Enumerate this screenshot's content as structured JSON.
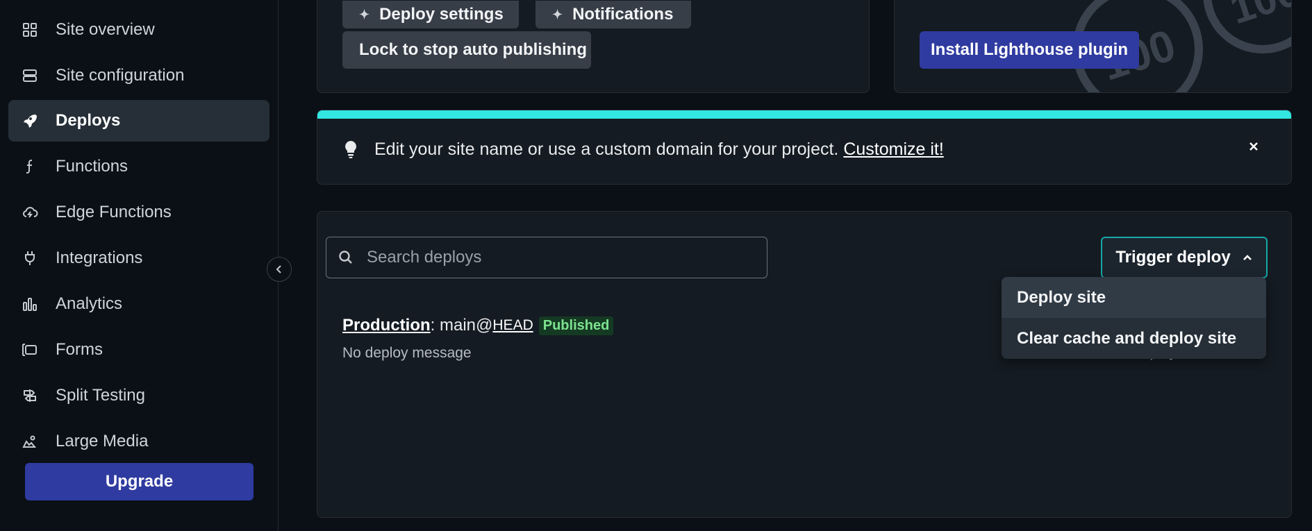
{
  "sidebar": {
    "items": [
      {
        "label": "Site overview",
        "icon": "grid-icon"
      },
      {
        "label": "Site configuration",
        "icon": "server-icon"
      },
      {
        "label": "Deploys",
        "icon": "rocket-icon",
        "active": true
      },
      {
        "label": "Functions",
        "icon": "lambda-icon"
      },
      {
        "label": "Edge Functions",
        "icon": "cloud-bolt-icon"
      },
      {
        "label": "Integrations",
        "icon": "plug-icon"
      },
      {
        "label": "Analytics",
        "icon": "bar-chart-icon"
      },
      {
        "label": "Forms",
        "icon": "form-icon"
      },
      {
        "label": "Split Testing",
        "icon": "signpost-icon"
      },
      {
        "label": "Large Media",
        "icon": "media-icon"
      }
    ],
    "upgrade_label": "Upgrade"
  },
  "deploy_settings_card": {
    "deploy_settings_label": "Deploy settings",
    "notifications_label": "Notifications",
    "lock_label": "Lock to stop auto publishing"
  },
  "lighthouse_card": {
    "install_label": "Install Lighthouse plugin",
    "score_decoration": "100"
  },
  "banner": {
    "text": "Edit your site name or use a custom domain for your project.",
    "link": "Customize it!",
    "accent_color": "#32e6e2"
  },
  "deploys": {
    "search_placeholder": "Search deploys",
    "trigger_label": "Trigger deploy",
    "dropdown": [
      "Deploy site",
      "Clear cache and deploy site"
    ],
    "row": {
      "environment": "Production",
      "branch": "main@",
      "commit": "HEAD",
      "status": "Published",
      "message": "No deploy message",
      "side_partial": "ploy"
    }
  },
  "colors": {
    "primary_button": "#2f3ba0",
    "trigger_border": "#17a8a6",
    "published_badge_bg": "#153a23",
    "published_badge_text": "#7de28f"
  }
}
